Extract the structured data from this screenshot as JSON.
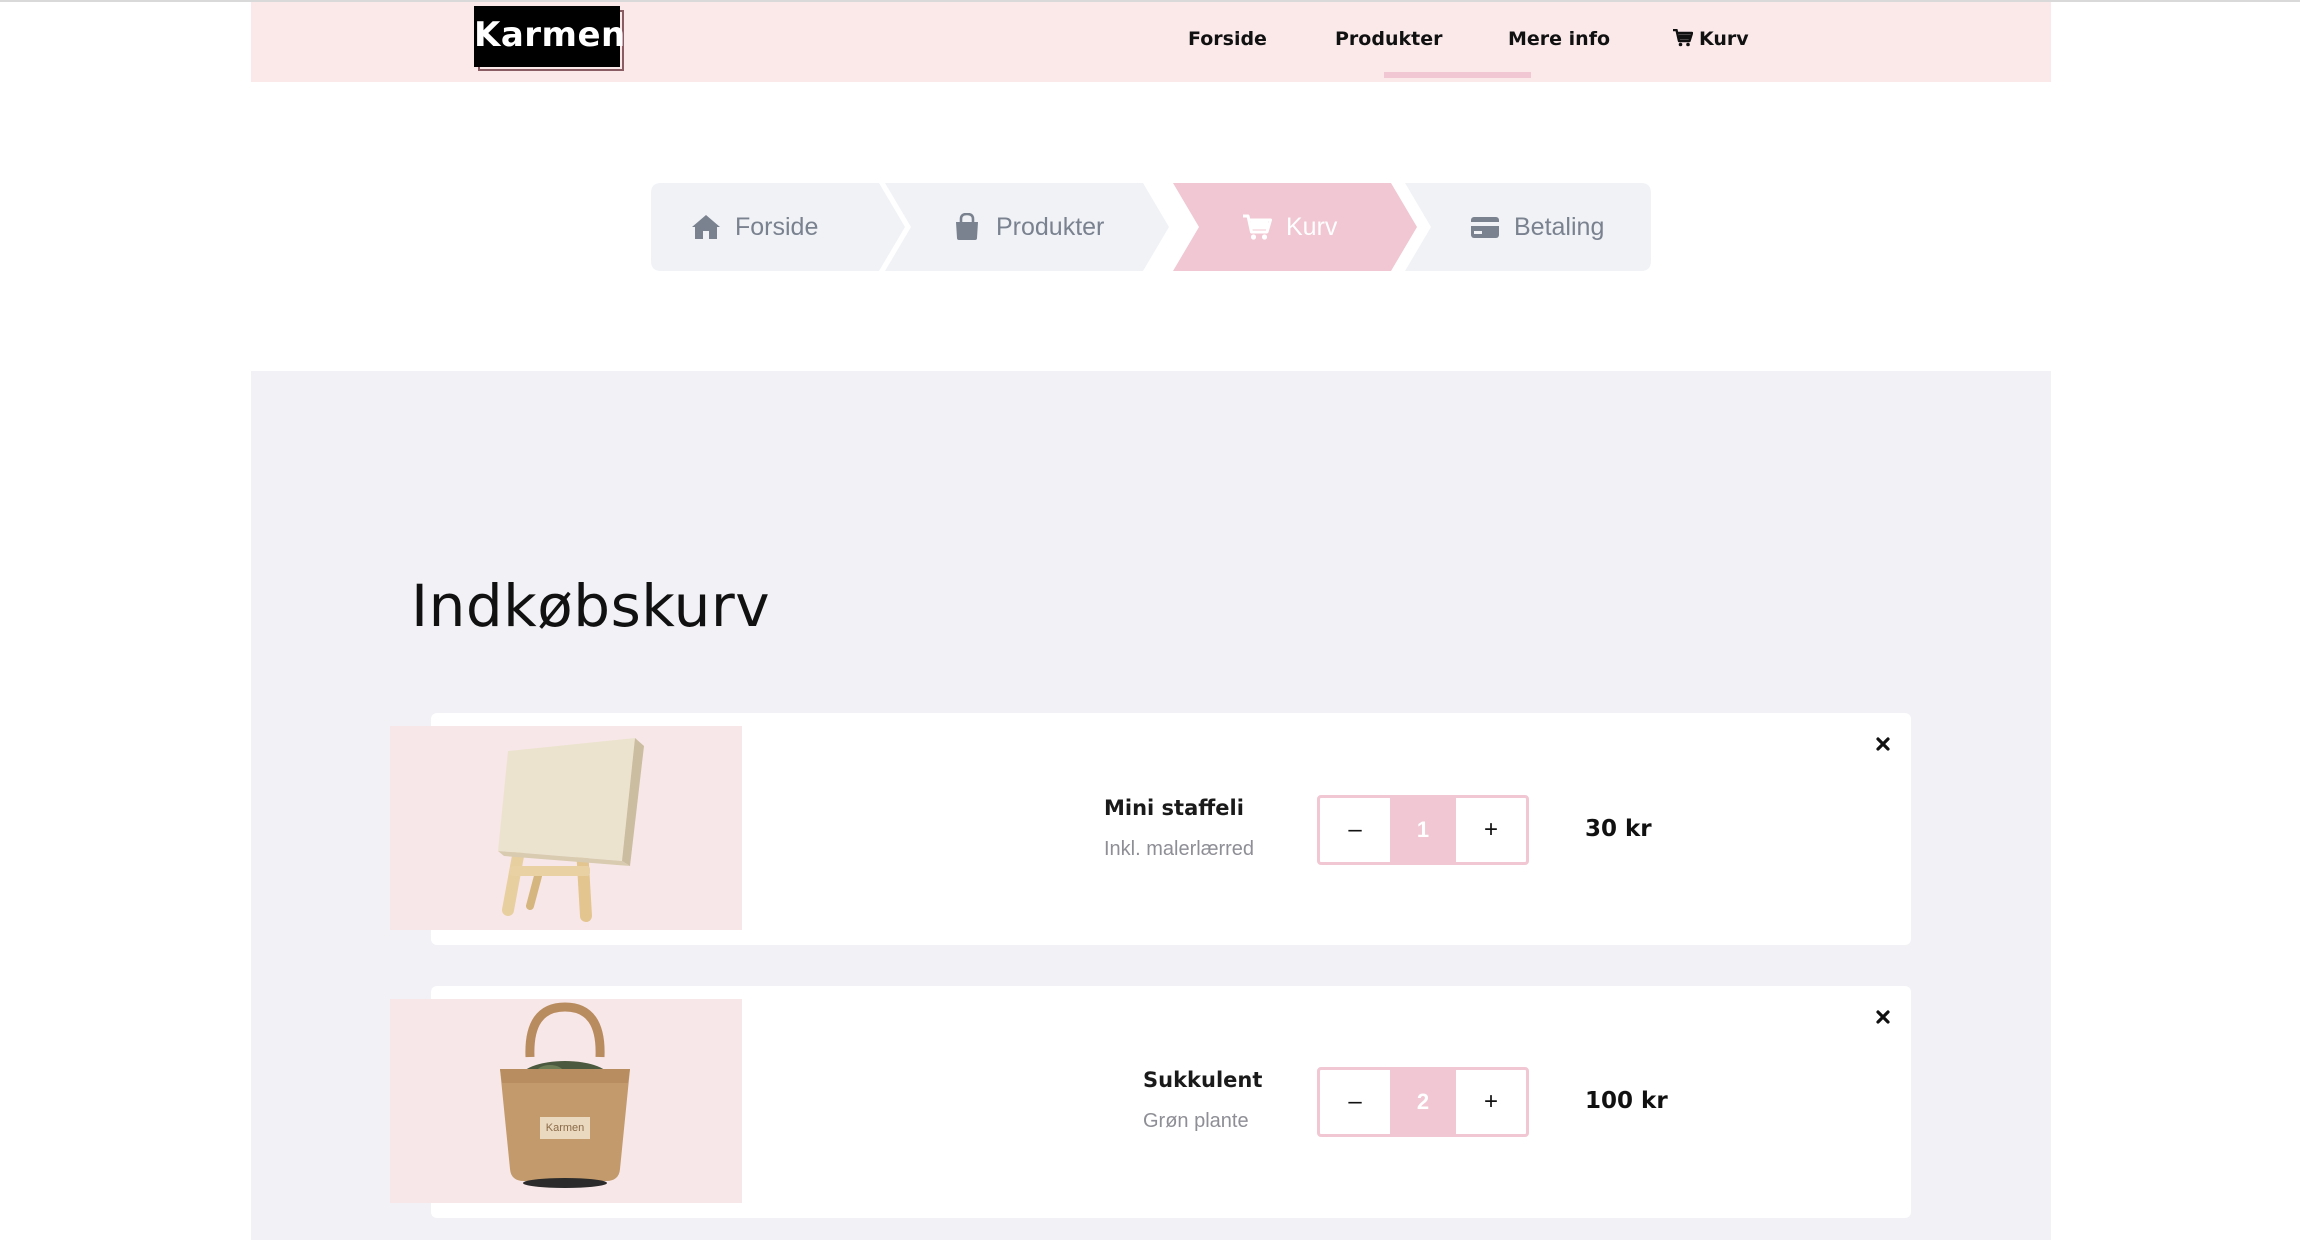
{
  "header": {
    "logo_text": "Karmen",
    "nav": [
      {
        "label": "Forside"
      },
      {
        "label": "Produkter"
      },
      {
        "label": "Mere info"
      },
      {
        "label": "Kurv",
        "icon": "cart-icon",
        "active": true
      }
    ]
  },
  "steps": [
    {
      "label": "Forside",
      "icon": "home-icon",
      "active": false
    },
    {
      "label": "Produkter",
      "icon": "shopping-bag-icon",
      "active": false
    },
    {
      "label": "Kurv",
      "icon": "cart-icon",
      "active": true
    },
    {
      "label": "Betaling",
      "icon": "credit-card-icon",
      "active": false
    }
  ],
  "cart": {
    "title": "Indkøbskurv",
    "items": [
      {
        "name": "Mini staffeli",
        "subtitle": "Inkl. malerlærred",
        "quantity": "1",
        "price": "30 kr",
        "decrement": "–",
        "increment": "+",
        "remove_icon": "close-icon"
      },
      {
        "name": "Sukkulent",
        "subtitle": "Grøn plante",
        "quantity": "2",
        "price": "100 kr",
        "decrement": "–",
        "increment": "+",
        "remove_icon": "close-icon",
        "bag_text": "Karmen"
      }
    ]
  },
  "colors": {
    "navbar_bg": "#fbe9ea",
    "accent_pink": "#f0c7d2",
    "step_inactive_bg": "#f0f2f6",
    "step_text": "#7a8290",
    "panel_bg": "#f2f2f6",
    "image_bg": "#f8e7e8"
  }
}
